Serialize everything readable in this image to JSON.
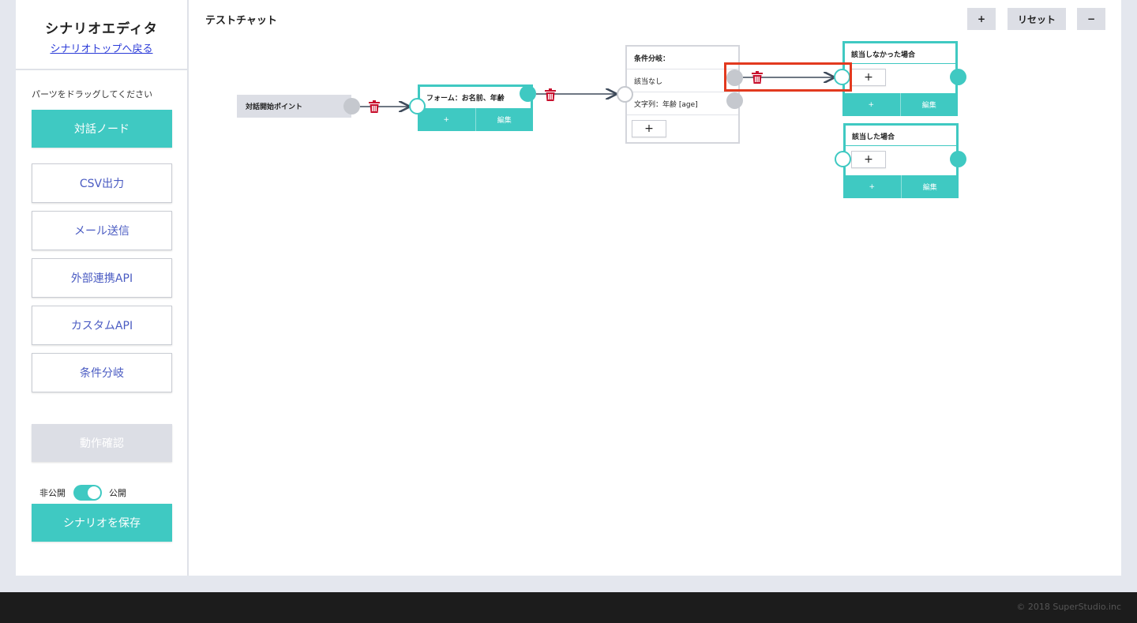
{
  "sidebar": {
    "title": "シナリオエディタ",
    "back_link": "シナリオトップへ戻る",
    "hint": "パーツをドラッグしてください",
    "parts": [
      "対話ノード",
      "CSV出力",
      "メール送信",
      "外部連携API",
      "カスタムAPI",
      "条件分岐"
    ],
    "test_button": "動作確認",
    "toggle": {
      "off_label": "非公開",
      "on_label": "公開",
      "state": "on"
    },
    "save_button": "シナリオを保存"
  },
  "canvas": {
    "title": "テストチャット",
    "zoom_in": "+",
    "reset": "リセット",
    "zoom_out": "−"
  },
  "nodes": {
    "start": {
      "label": "対話開始ポイント"
    },
    "form": {
      "label": "フォーム：お名前、年齢",
      "add": "+",
      "edit": "編集"
    },
    "condition": {
      "label": "条件分岐：",
      "rows": [
        "該当なし",
        "文字列：年齢 [age]"
      ],
      "add": "+"
    },
    "not_matched": {
      "label": "該当しなかった場合",
      "add_inner": "+",
      "add": "+",
      "edit": "編集"
    },
    "matched": {
      "label": "該当した場合",
      "add_inner": "+",
      "add": "+",
      "edit": "編集"
    }
  },
  "colors": {
    "accent": "#3fc9c2",
    "link": "#2b3bd8",
    "highlight": "#e23a1f",
    "delete": "#c8102e"
  },
  "footer": {
    "copyright": "© 2018 SuperStudio.inc"
  }
}
